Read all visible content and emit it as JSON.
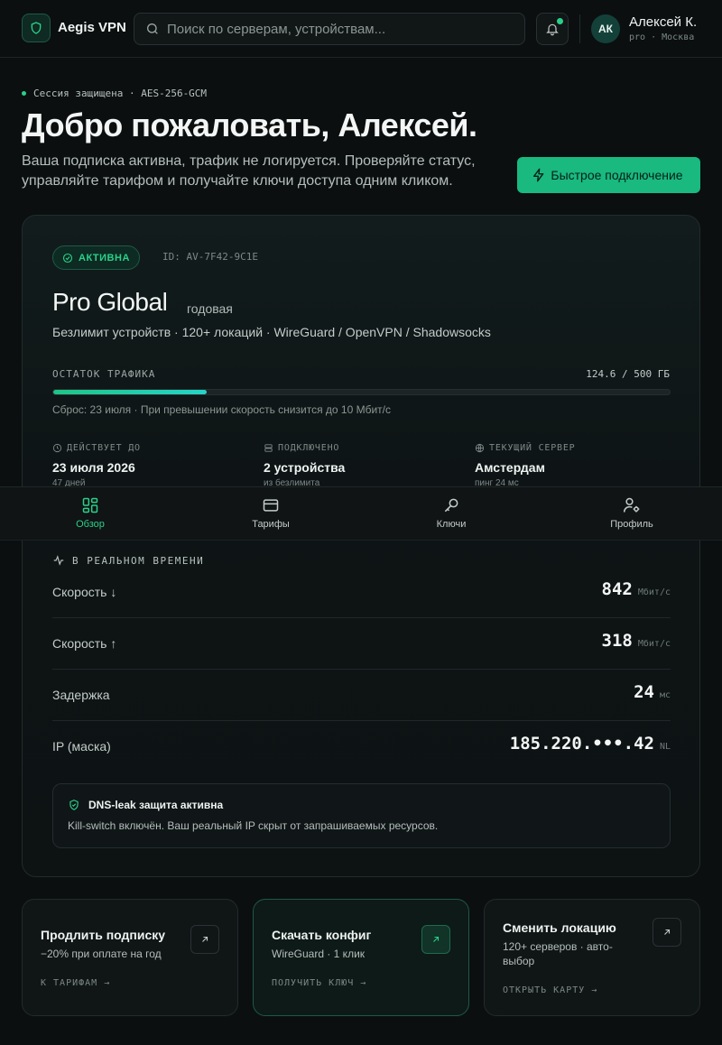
{
  "header": {
    "brand": "Aegis VPN",
    "search_placeholder": "Поиск по серверам, устройствам...",
    "user": {
      "initials": "АК",
      "name": "Алексей К.",
      "meta": "pro · Москва"
    }
  },
  "hero": {
    "session": "Сессия защищена · AES-256-GCM",
    "title": "Добро пожаловать, Алексей.",
    "subtitle": "Ваша подписка активна, трафик не логируется. Проверяйте статус, управляйте тарифом и получайте ключи доступа одним кликом.",
    "quick_connect": "Быстрое подключение"
  },
  "plan": {
    "status": "АКТИВНА",
    "id": "ID: AV-7F42-9C1E",
    "name": "Pro Global",
    "period": "годовая",
    "description": "Безлимит устройств · 120+ локаций · WireGuard / OpenVPN / Shadowsocks",
    "traffic_label": "ОСТАТОК ТРАФИКА",
    "traffic_value": "124.6 / 500 ГБ",
    "traffic_fraction": 0.249,
    "traffic_note": "Сброс: 23 июля · При превышении скорость снизится до 10 Мбит/с",
    "stats": [
      {
        "label": "ДЕЙСТВУЕТ ДО",
        "value": "23 июля 2026",
        "sub": "47 дней",
        "icon": "clock-icon"
      },
      {
        "label": "ПОДКЛЮЧЕНО",
        "value": "2 устройства",
        "sub": "из безлимита",
        "icon": "server-icon"
      },
      {
        "label": "ТЕКУЩИЙ СЕРВЕР",
        "value": "Амстердам",
        "sub": "пинг 24 мс",
        "icon": "globe-icon"
      }
    ]
  },
  "realtime": {
    "label": "В РЕАЛЬНОМ ВРЕМЕНИ",
    "rows": [
      {
        "label": "Скорость ↓",
        "value": "842",
        "unit": "Мбит/с"
      },
      {
        "label": "Скорость ↑",
        "value": "318",
        "unit": "Мбит/с"
      },
      {
        "label": "Задержка",
        "value": "24",
        "unit": "мс"
      },
      {
        "label": "IP (маска)",
        "value": "185.220.•••.42",
        "unit": "NL"
      }
    ],
    "dns_title": "DNS-leak защита активна",
    "dns_desc": "Kill-switch включён. Ваш реальный IP скрыт от запрашиваемых ресурсов."
  },
  "nav": [
    {
      "label": "Обзор",
      "icon": "dashboard-icon",
      "active": true
    },
    {
      "label": "Тарифы",
      "icon": "card-icon",
      "active": false
    },
    {
      "label": "Ключи",
      "icon": "key-icon",
      "active": false
    },
    {
      "label": "Профиль",
      "icon": "profile-settings-icon",
      "active": false
    }
  ],
  "actions": [
    {
      "title": "Продлить подписку",
      "desc": "−20% при оплате на год",
      "link": "К ТАРИФАМ →"
    },
    {
      "title": "Скачать конфиг",
      "desc": "WireGuard · 1 клик",
      "link": "ПОЛУЧИТЬ КЛЮЧ →"
    },
    {
      "title": "Сменить локацию",
      "desc": "120+ серверов · авто-выбор",
      "link": "ОТКРЫТЬ КАРТУ →"
    }
  ],
  "colors": {
    "accent": "#2ad08a",
    "button": "#19b980",
    "background": "#0b0f10"
  }
}
